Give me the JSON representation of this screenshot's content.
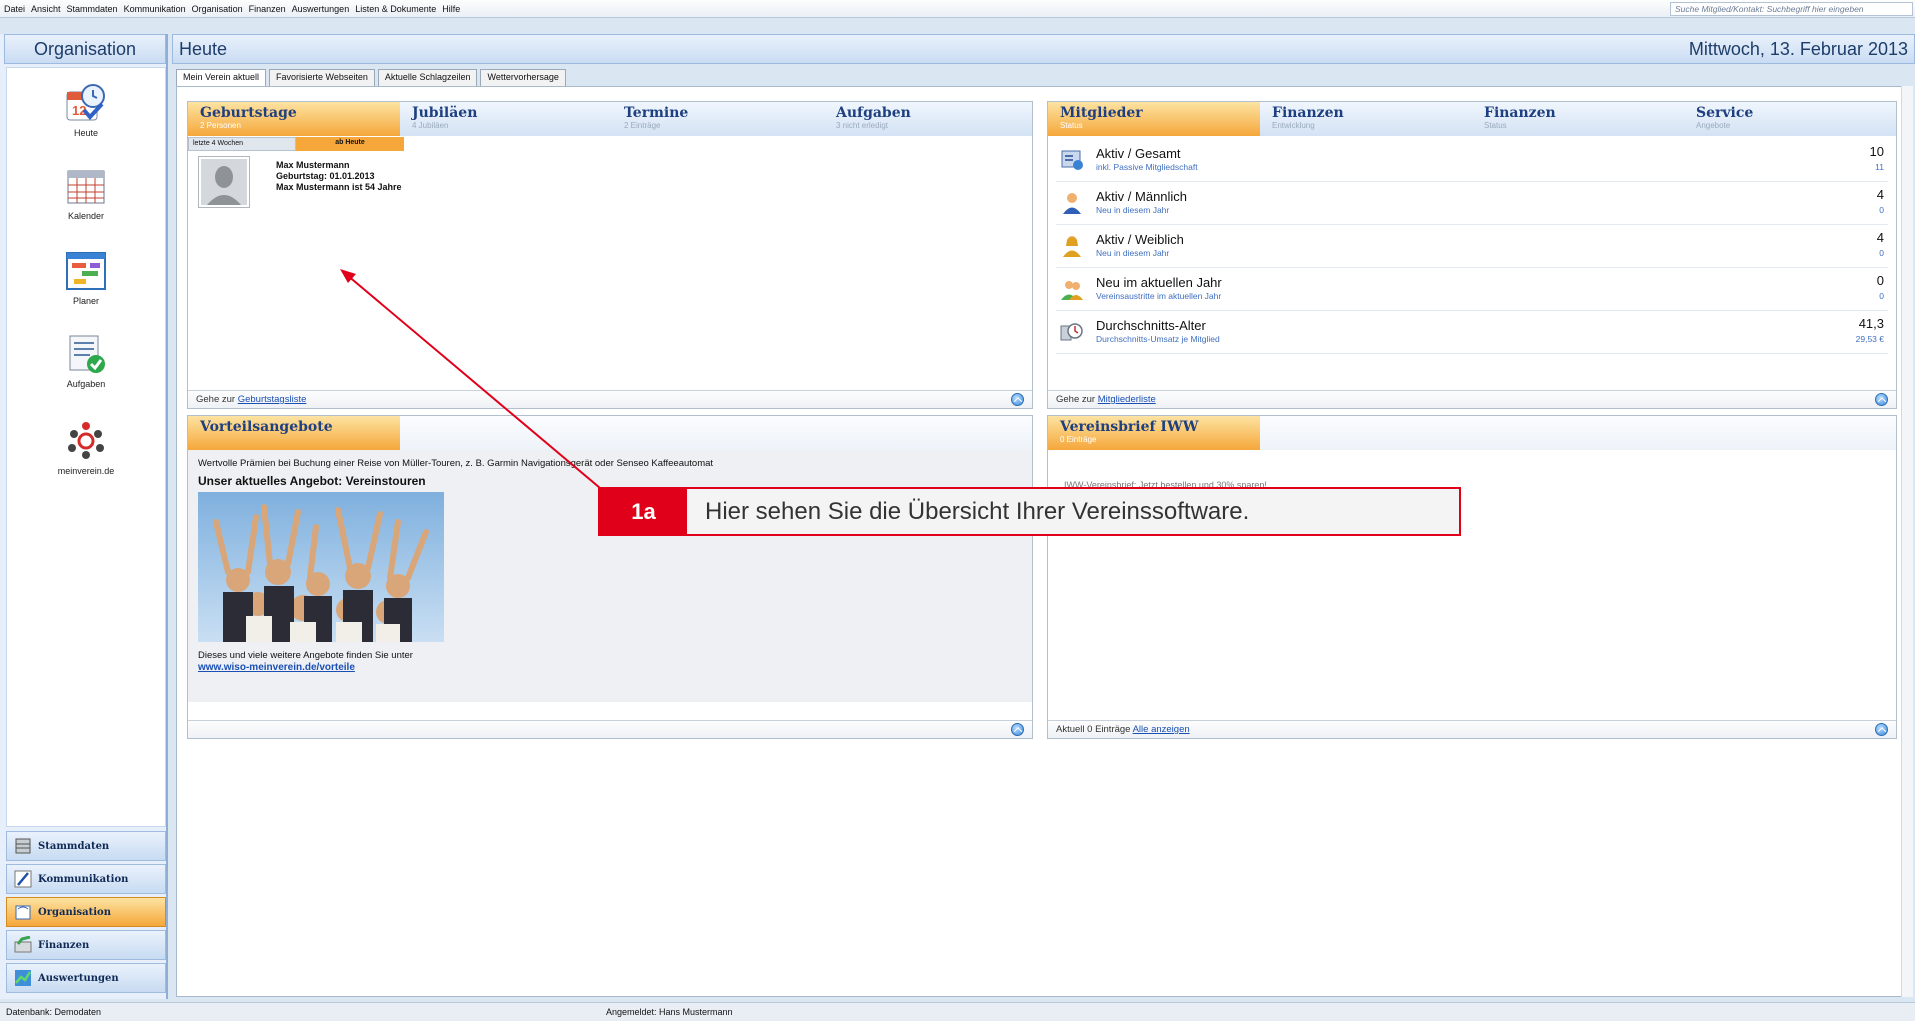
{
  "menu": {
    "items": [
      "Datei",
      "Ansicht",
      "Stammdaten",
      "Kommunikation",
      "Organisation",
      "Finanzen",
      "Auswertungen",
      "Listen & Dokumente",
      "Hilfe"
    ],
    "search_placeholder": "Suche Mitglied/Kontakt: Suchbegriff hier eingeben"
  },
  "sidebar": {
    "title": "Organisation",
    "items": [
      {
        "label": "Heute",
        "icon": "clock-calendar-icon"
      },
      {
        "label": "Kalender",
        "icon": "calendar-icon"
      },
      {
        "label": "Planer",
        "icon": "planner-icon"
      },
      {
        "label": "Aufgaben",
        "icon": "tasks-icon"
      },
      {
        "label": "meinverein.de",
        "icon": "meinverein-icon"
      }
    ],
    "nav": [
      {
        "label": "Stammdaten",
        "icon": "database-icon"
      },
      {
        "label": "Kommunikation",
        "icon": "pen-icon"
      },
      {
        "label": "Organisation",
        "icon": "folder-icon",
        "active": true
      },
      {
        "label": "Finanzen",
        "icon": "finance-icon"
      },
      {
        "label": "Auswertungen",
        "icon": "chart-icon"
      }
    ]
  },
  "header": {
    "title": "Heute",
    "date": "Mittwoch, 13. Februar 2013"
  },
  "tabs": [
    "Mein Verein aktuell",
    "Favorisierte Webseiten",
    "Aktuelle Schlagzeilen",
    "Wettervorhersage"
  ],
  "panel1": {
    "tabs": [
      {
        "title": "Geburtstage",
        "sub": "2 Personen"
      },
      {
        "title": "Jubiläen",
        "sub": "4 Jubiläen"
      },
      {
        "title": "Termine",
        "sub": "2 Einträge"
      },
      {
        "title": "Aufgaben",
        "sub": "3 nicht erledigt"
      }
    ],
    "subtabs": [
      "letzte 4 Wochen",
      "ab Heute"
    ],
    "person": {
      "name": "Max Mustermann",
      "birthday": "Geburtstag: 01.01.2013",
      "age": "Max Mustermann ist 54 Jahre"
    },
    "footer_prefix": "Gehe zur",
    "footer_link": "Geburtstagsliste"
  },
  "panel2": {
    "tabs": [
      {
        "title": "Mitglieder",
        "sub": "Status"
      },
      {
        "title": "Finanzen",
        "sub": "Entwicklung"
      },
      {
        "title": "Finanzen",
        "sub": "Status"
      },
      {
        "title": "Service",
        "sub": "Angebote"
      }
    ],
    "rows": [
      {
        "label": "Aktiv / Gesamt",
        "sub": "inkl. Passive Mitgliedschaft",
        "value": "10",
        "value2": "11"
      },
      {
        "label": "Aktiv / Männlich",
        "sub": "Neu in diesem Jahr",
        "value": "4",
        "value2": "0"
      },
      {
        "label": "Aktiv / Weiblich",
        "sub": "Neu in diesem Jahr",
        "value": "4",
        "value2": "0"
      },
      {
        "label": "Neu im aktuellen Jahr",
        "sub": "Vereinsaustritte im aktuellen Jahr",
        "value": "0",
        "value2": "0"
      },
      {
        "label": "Durchschnitts-Alter",
        "sub": "Durchschnitts-Umsatz je Mitglied",
        "value": "41,3",
        "value2": "29,53 €"
      }
    ],
    "footer_prefix": "Gehe zur",
    "footer_link": "Mitgliederliste"
  },
  "panel3": {
    "tab": "Vorteilsangebote",
    "intro": "Wertvolle Prämien bei Buchung einer Reise von Müller-Touren, z. B. Garmin Navigationsgerät oder Senseo Kaffeeautomat",
    "heading": "Unser aktuelles Angebot: Vereinstouren",
    "outro": "Dieses und viele weitere Angebote finden Sie unter",
    "link": "www.wiso-meinverein.de/vorteile"
  },
  "panel4": {
    "tab": "Vereinsbrief IWW",
    "sub": "0 Einträge",
    "partial": "IWW-Vereinsbrief: Jetzt bestellen und 30% sparen!",
    "footer_prefix": "Aktuell 0 Einträge",
    "footer_link": "Alle anzeigen"
  },
  "callout": {
    "num": "1a",
    "text": "Hier sehen Sie die Übersicht Ihrer Vereinssoftware."
  },
  "status": {
    "db": "Datenbank: Demodaten",
    "user": "Angemeldet: Hans Mustermann"
  },
  "colors": {
    "accent": "#e1001a",
    "tab_active": "#f5a73a",
    "link": "#1a4fb4"
  }
}
